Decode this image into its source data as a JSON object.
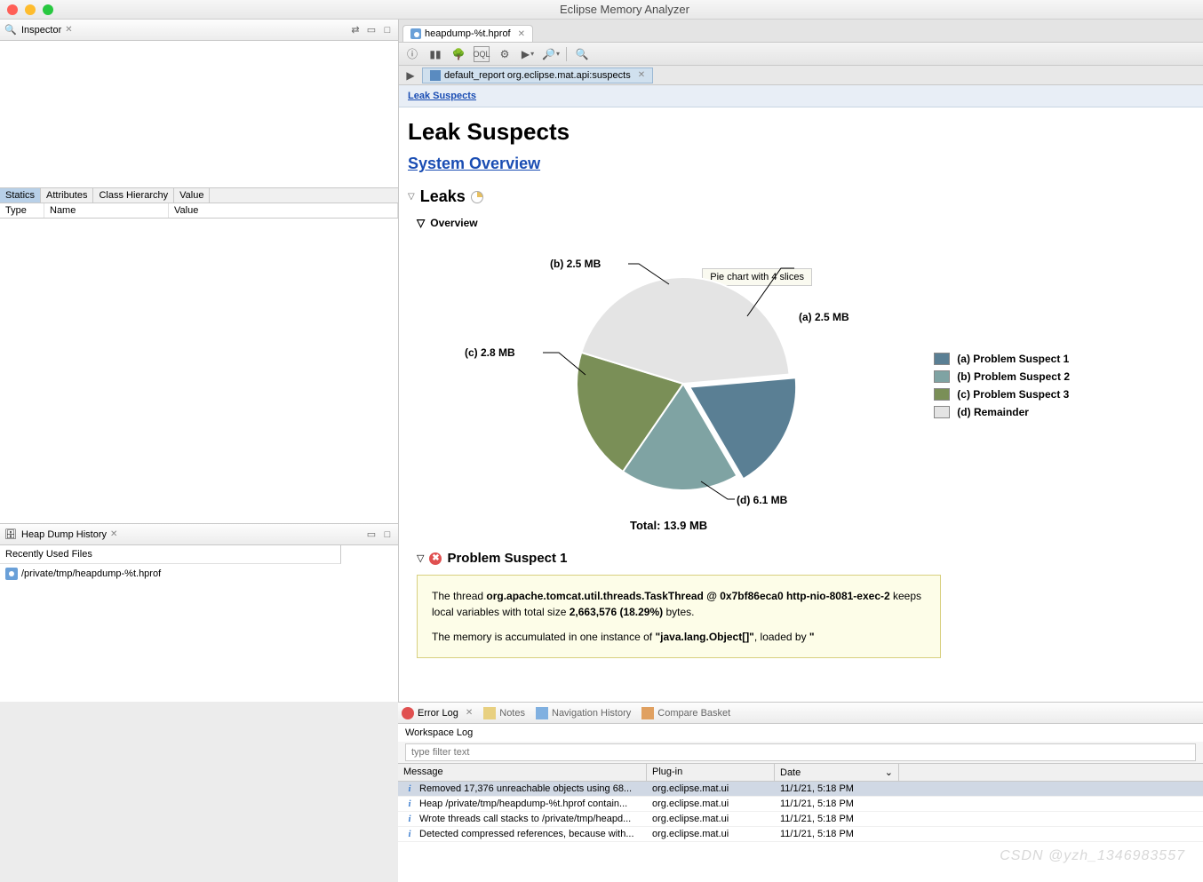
{
  "app_title": "Eclipse Memory Analyzer",
  "inspector": {
    "title": "Inspector",
    "tabs": [
      "Statics",
      "Attributes",
      "Class Hierarchy",
      "Value"
    ],
    "active_tab": 0,
    "columns": {
      "type": "Type",
      "name": "Name",
      "value": "Value"
    }
  },
  "heap_history": {
    "title": "Heap Dump History",
    "recently_used": "Recently Used Files",
    "file": "/private/tmp/heapdump-%t.hprof"
  },
  "editor": {
    "tab_label": "heapdump-%t.hprof",
    "subtab_label": "default_report  org.eclipse.mat.api:suspects"
  },
  "report": {
    "breadcrumb": "Leak Suspects",
    "title": "Leak Suspects",
    "system_overview": "System Overview",
    "leaks_heading": "Leaks",
    "overview_heading": "Overview",
    "tooltip": "Pie chart with 4 slices",
    "total_label": "Total: 13.9 MB",
    "suspect1_heading": "Problem Suspect 1",
    "suspect1_p1_a": "The thread ",
    "suspect1_p1_b": "org.apache.tomcat.util.threads.TaskThread @ 0x7bf86eca0 http-nio-8081-exec-2",
    "suspect1_p1_c": " keeps local variables with total size ",
    "suspect1_p1_d": "2,663,576 (18.29%)",
    "suspect1_p1_e": " bytes.",
    "suspect1_p2_a": "The memory is accumulated in one instance of ",
    "suspect1_p2_b": "\"java.lang.Object[]\"",
    "suspect1_p2_c": ", loaded by ",
    "suspect1_p2_d": "\""
  },
  "chart_data": {
    "type": "pie",
    "title": "Leaks Overview",
    "total": "13.9 MB",
    "series": [
      {
        "key": "a",
        "name": "Problem Suspect 1",
        "value": 2.5,
        "label": "(a)  2.5 MB",
        "color": "#5a7f94"
      },
      {
        "key": "b",
        "name": "Problem Suspect 2",
        "value": 2.5,
        "label": "(b)  2.5 MB",
        "color": "#7fa3a3"
      },
      {
        "key": "c",
        "name": "Problem Suspect 3",
        "value": 2.8,
        "label": "(c)  2.8 MB",
        "color": "#7a8f57"
      },
      {
        "key": "d",
        "name": "Remainder",
        "value": 6.1,
        "label": "(d)  6.1 MB",
        "color": "#e4e4e4"
      }
    ],
    "legend": [
      "(a)  Problem Suspect 1",
      "(b)  Problem Suspect 2",
      "(c)  Problem Suspect 3",
      "(d)  Remainder"
    ]
  },
  "bottom": {
    "tabs": {
      "error_log": "Error Log",
      "notes": "Notes",
      "nav_history": "Navigation History",
      "compare": "Compare Basket"
    },
    "workspace_log": "Workspace Log",
    "filter_placeholder": "type filter text",
    "columns": {
      "message": "Message",
      "plugin": "Plug-in",
      "date": "Date"
    },
    "rows": [
      {
        "msg": "Removed 17,376 unreachable objects using 68...",
        "plugin": "org.eclipse.mat.ui",
        "date": "11/1/21, 5:18 PM",
        "sel": true
      },
      {
        "msg": "Heap /private/tmp/heapdump-%t.hprof contain...",
        "plugin": "org.eclipse.mat.ui",
        "date": "11/1/21, 5:18 PM",
        "sel": false
      },
      {
        "msg": "Wrote threads call stacks to /private/tmp/heapd...",
        "plugin": "org.eclipse.mat.ui",
        "date": "11/1/21, 5:18 PM",
        "sel": false
      },
      {
        "msg": "Detected compressed references, because with...",
        "plugin": "org.eclipse.mat.ui",
        "date": "11/1/21, 5:18 PM",
        "sel": false
      }
    ]
  },
  "watermark": "CSDN @yzh_1346983557"
}
